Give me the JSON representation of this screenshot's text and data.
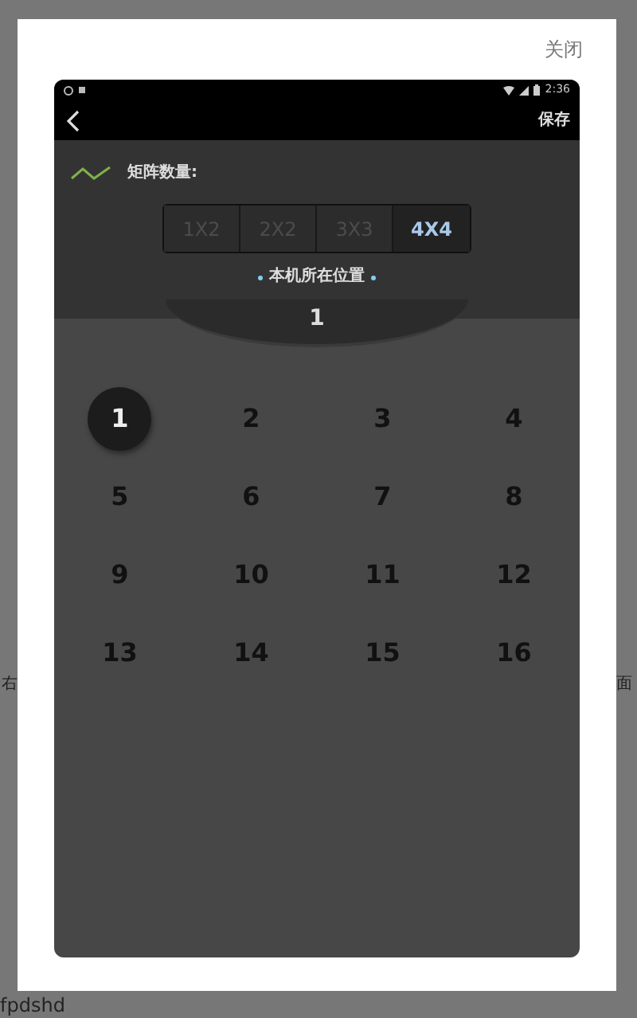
{
  "page": {
    "side_text_left": "右",
    "side_text_right": "面",
    "footer_text": "fpdshd"
  },
  "dialog": {
    "close_label": "关闭"
  },
  "phone": {
    "status_bar": {
      "time": "2:36"
    },
    "nav": {
      "save_label": "保存"
    },
    "matrix": {
      "label": "矩阵数量:",
      "options": [
        {
          "label": "1X2",
          "selected": false
        },
        {
          "label": "2X2",
          "selected": false
        },
        {
          "label": "3X3",
          "selected": false
        },
        {
          "label": "4X4",
          "selected": true
        }
      ]
    },
    "position_label": "本机所在位置",
    "position_value": "1",
    "grid": [
      {
        "label": "1",
        "selected": true
      },
      {
        "label": "2",
        "selected": false
      },
      {
        "label": "3",
        "selected": false
      },
      {
        "label": "4",
        "selected": false
      },
      {
        "label": "5",
        "selected": false
      },
      {
        "label": "6",
        "selected": false
      },
      {
        "label": "7",
        "selected": false
      },
      {
        "label": "8",
        "selected": false
      },
      {
        "label": "9",
        "selected": false
      },
      {
        "label": "10",
        "selected": false
      },
      {
        "label": "11",
        "selected": false
      },
      {
        "label": "12",
        "selected": false
      },
      {
        "label": "13",
        "selected": false
      },
      {
        "label": "14",
        "selected": false
      },
      {
        "label": "15",
        "selected": false
      },
      {
        "label": "16",
        "selected": false
      }
    ]
  }
}
